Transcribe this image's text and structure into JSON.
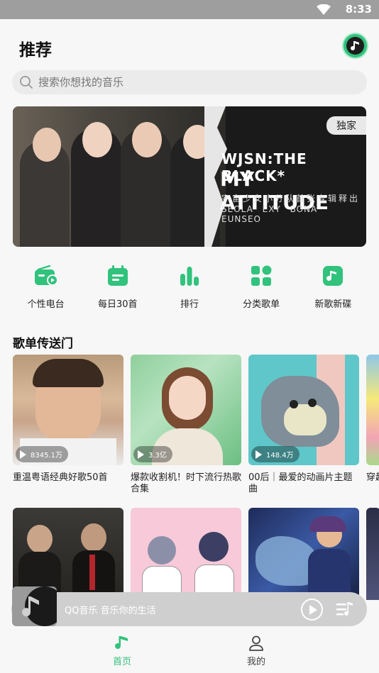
{
  "status_bar": {
    "time": "8:33",
    "icons": [
      "wifi-icon"
    ]
  },
  "header": {
    "title": "推荐",
    "music_icon": "music-note-icon"
  },
  "search": {
    "placeholder": "搜索你想找的音乐",
    "icon": "search-icon"
  },
  "banner": {
    "badge": "独家",
    "line1": "WJSN:THE BLACK*",
    "line2": "MY ATTITUDE",
    "line3": "宇宙少女小分队首张专辑释出",
    "line4": "SEOLA EXY BONA EUNSEO"
  },
  "quick_links": [
    {
      "label": "个性电台",
      "icon": "radio-icon"
    },
    {
      "label": "每日30首",
      "icon": "calendar-icon"
    },
    {
      "label": "排行",
      "icon": "bar-chart-icon"
    },
    {
      "label": "分类歌单",
      "icon": "grid-icon"
    },
    {
      "label": "新歌新碟",
      "icon": "music-note-icon"
    }
  ],
  "section": {
    "title": "歌单传送门"
  },
  "playlists": [
    {
      "name": "重温粤语经典好歌50首",
      "plays": "8345.1万"
    },
    {
      "name": "爆款收割机！时下流行热歌合集",
      "plays": "3.3亿"
    },
    {
      "name": "00后｜最爱的动画片主题曲",
      "plays": "148.4万"
    },
    {
      "name": "穿越",
      "plays": ""
    }
  ],
  "player": {
    "text": "QQ音乐 音乐你的生活"
  },
  "tabs": [
    {
      "label": "首页",
      "icon": "music-note-icon",
      "active": true
    },
    {
      "label": "我的",
      "icon": "user-icon",
      "active": false
    }
  ],
  "colors": {
    "accent": "#31c27c",
    "text": "#222222",
    "background": "#f7f7f7"
  }
}
